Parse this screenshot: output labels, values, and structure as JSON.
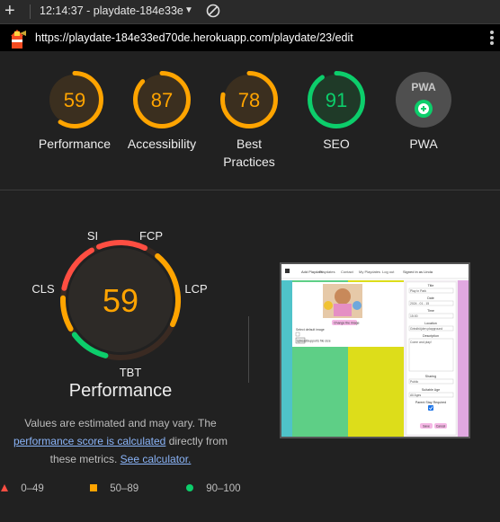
{
  "toolbar": {
    "tab_title": "12:14:37 - playdate-184e33e",
    "url": "https://playdate-184e33ed70de.herokuapp.com/playdate/23/edit"
  },
  "colors": {
    "pass": "#0cce6b",
    "average": "#ffa400",
    "fail": "#ff4e42"
  },
  "categories": [
    {
      "score": "59",
      "label": "Performance",
      "value": 0.59,
      "rating": "average"
    },
    {
      "score": "87",
      "label": "Accessibility",
      "value": 0.87,
      "rating": "average"
    },
    {
      "score": "78",
      "label": "Best Practices",
      "value": 0.78,
      "rating": "average"
    },
    {
      "score": "91",
      "label": "SEO",
      "value": 0.91,
      "rating": "pass"
    },
    {
      "score": "PWA",
      "label": "PWA",
      "value": null,
      "rating": "pwa"
    }
  ],
  "performance": {
    "score": "59",
    "title": "Performance",
    "metrics": {
      "si": "SI",
      "fcp": "FCP",
      "lcp": "LCP",
      "tbt": "TBT",
      "cls": "CLS"
    },
    "note_1": "Values are estimated and may vary. The",
    "note_link": "performance score is calculated",
    "note_2": "directly from",
    "note_3": "these metrics.",
    "calc_link": "See calculator."
  },
  "legend": {
    "fail": "0–49",
    "average": "50–89",
    "pass": "90–100"
  },
  "screenshot": {
    "nav_brand": "Add Playdate",
    "nav_items": [
      "Playdates",
      "Contact",
      "My Playdates",
      "Log out",
      "Signed in as Linda"
    ],
    "change_image_btn": "Change the image",
    "form_labels": [
      "Title",
      "Date",
      "Time",
      "Location",
      "Description",
      "Sharing",
      "Suitable Age",
      "Parent Stay Required"
    ],
    "title_value": "Play in Park",
    "date_value": "2024 - 01 - 15",
    "time_value": "15:00",
    "location_value": "Grindhöjden playground",
    "description_placeholder": "Come and play!",
    "sharing_value": "Public",
    "age_value": "All Ages",
    "left_label": "Select default image",
    "upload_btn": "Upload",
    "upload_text": "Supports file size",
    "save_btn": "Save",
    "cancel_btn": "Cancel"
  }
}
